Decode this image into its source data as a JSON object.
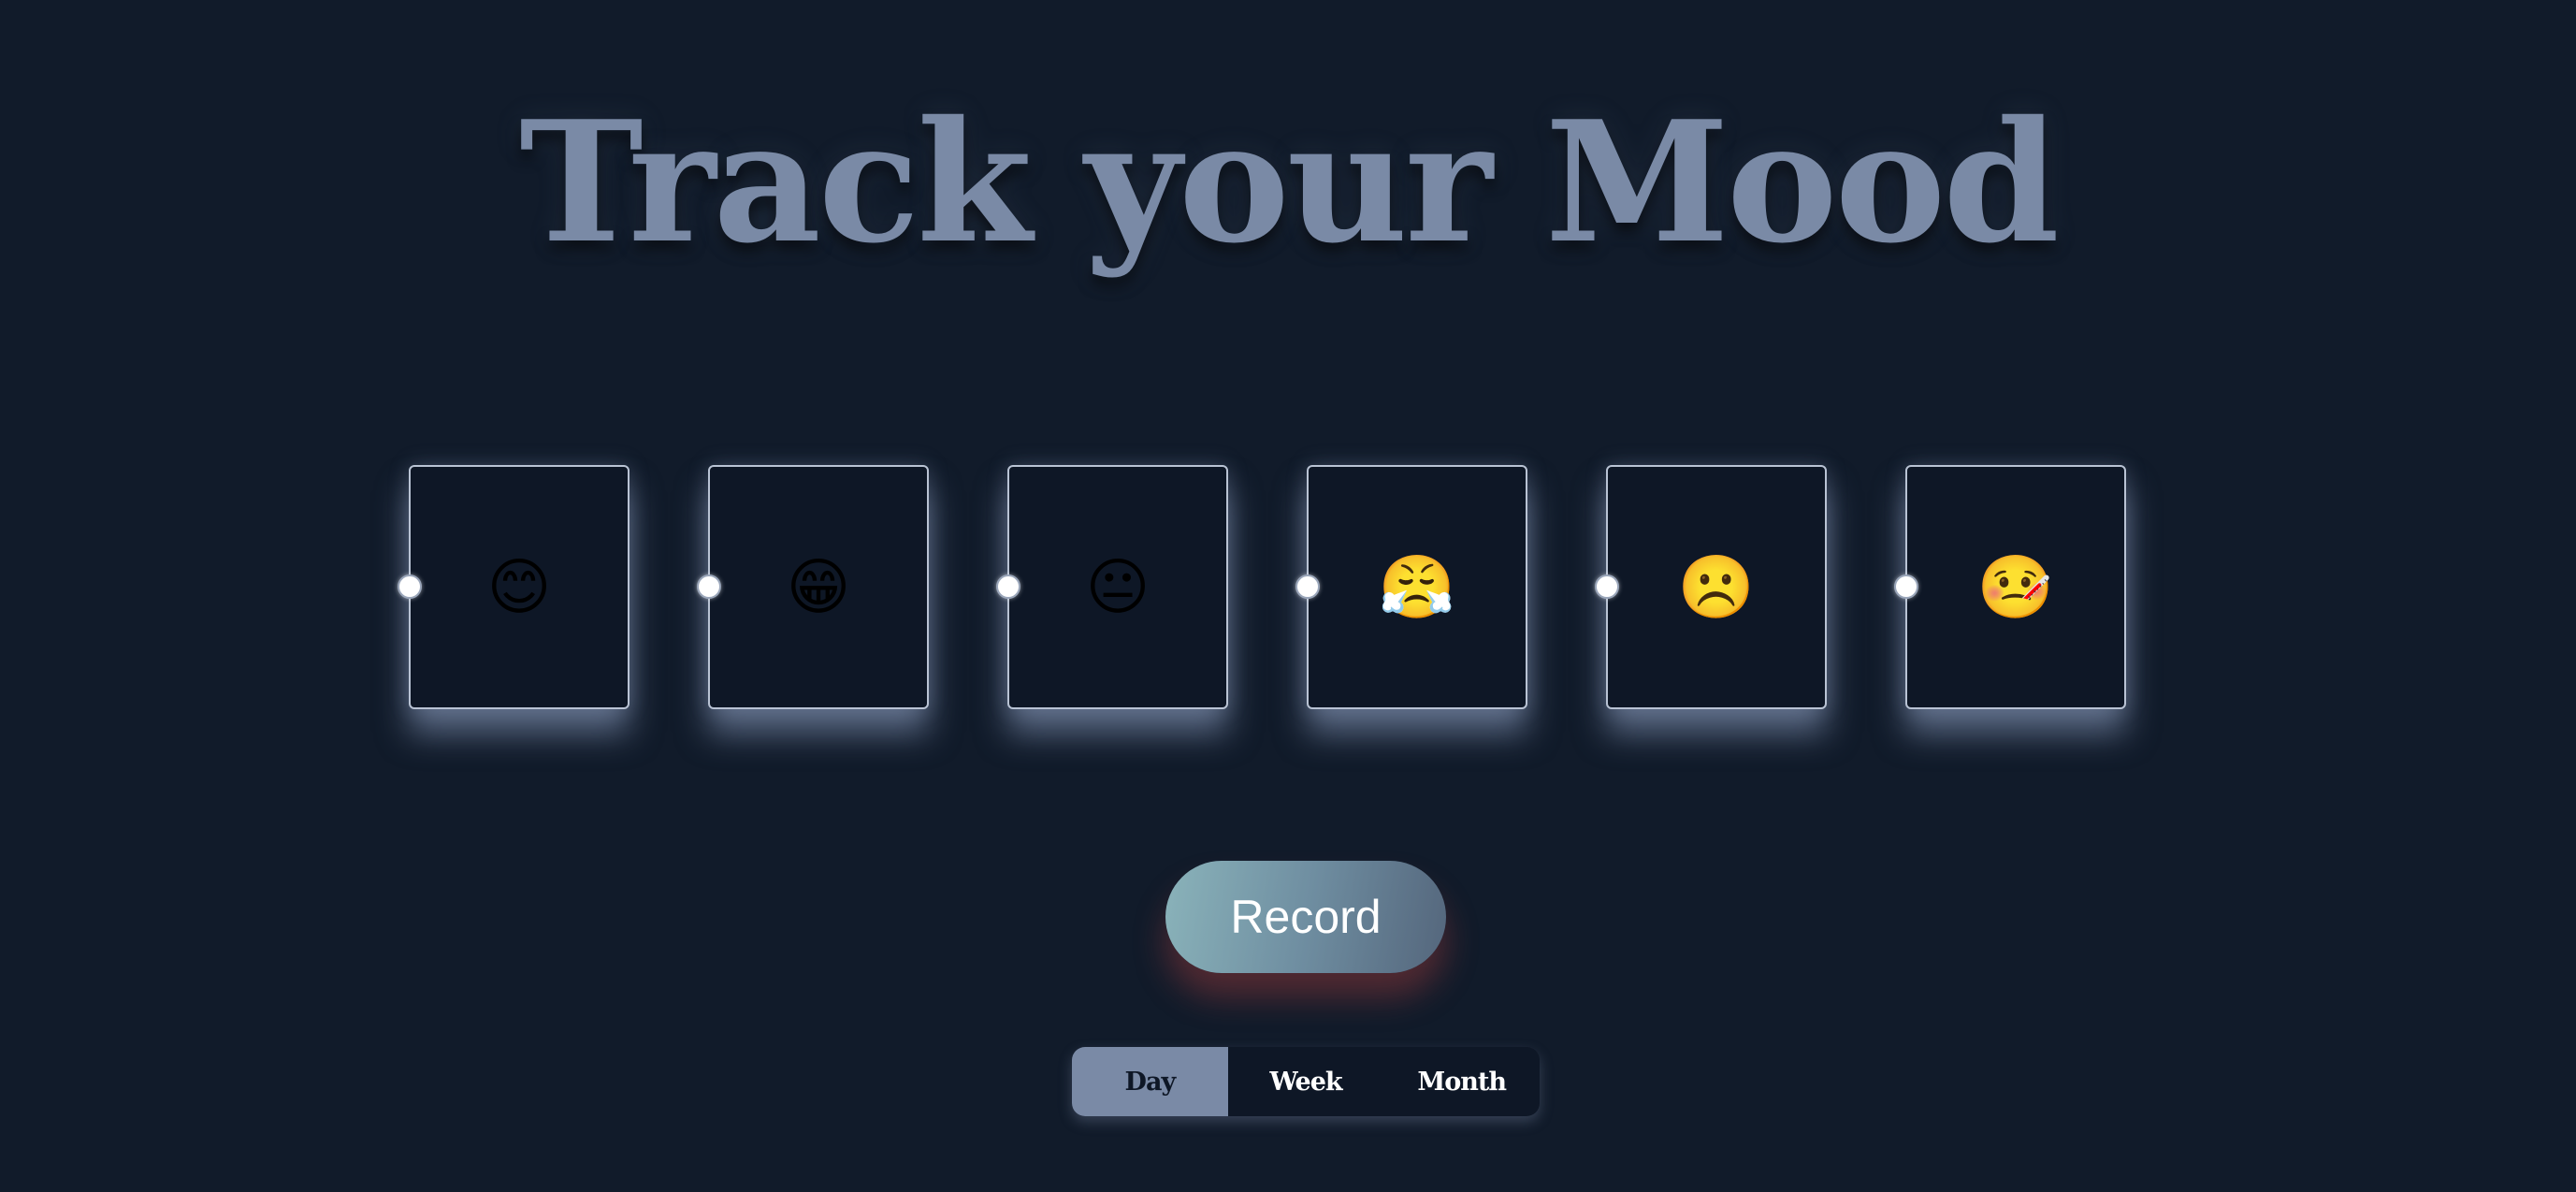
{
  "title": "Track your Mood",
  "moods": [
    {
      "emoji": "😊",
      "icon": "smiling-face-icon"
    },
    {
      "emoji": "😁",
      "icon": "grinning-face-icon"
    },
    {
      "emoji": "😐",
      "icon": "neutral-face-icon"
    },
    {
      "emoji": "😤",
      "icon": "steam-face-icon"
    },
    {
      "emoji": "☹️",
      "icon": "frowning-face-icon"
    },
    {
      "emoji": "🤒",
      "icon": "thermometer-face-icon"
    }
  ],
  "record_label": "Record",
  "periods": [
    "Day",
    "Week",
    "Month"
  ],
  "selected_period": "Day",
  "colors": {
    "background": "#111b2a",
    "title": "#7a8aa6",
    "card_border": "#b9c3d4",
    "card_glow": "#93a5c8",
    "active_tab": "#7a8aa6"
  }
}
